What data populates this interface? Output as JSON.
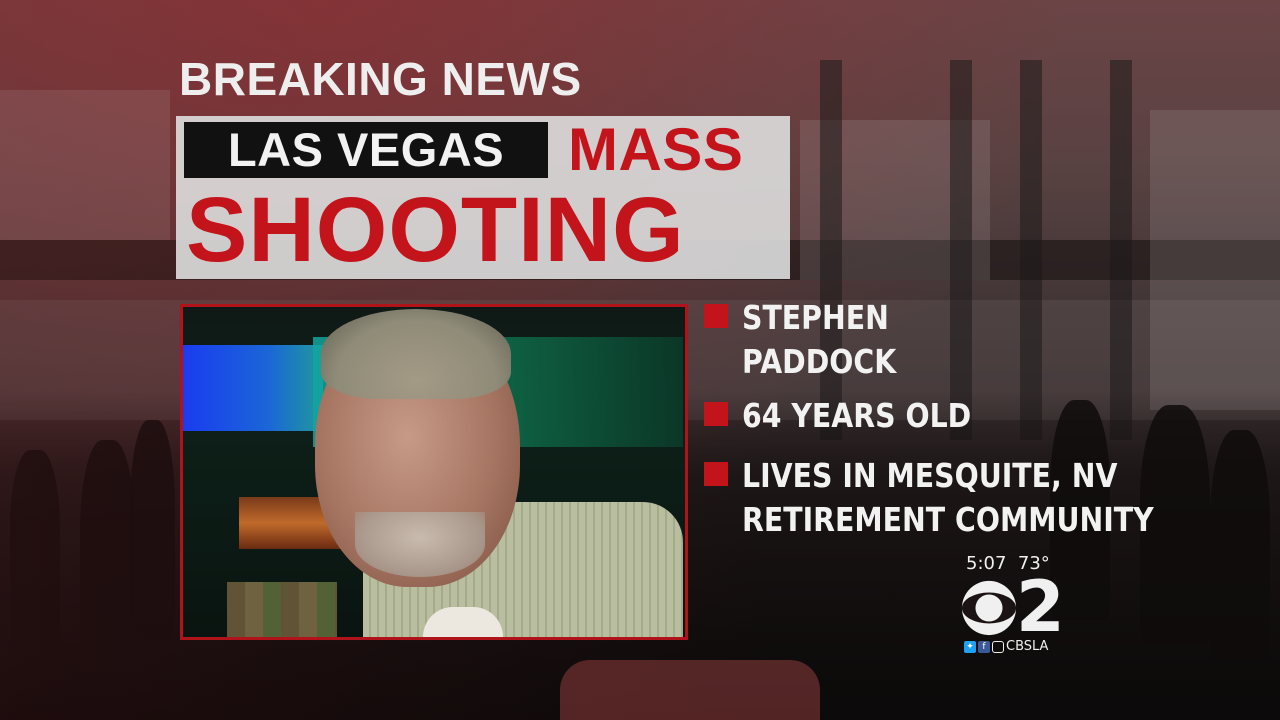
{
  "headline": {
    "kicker": "BREAKING NEWS",
    "location": "LAS VEGAS",
    "title_part1": "MASS",
    "title_part2": "SHOOTING"
  },
  "facts": [
    {
      "lines": [
        "STEPHEN",
        "PADDOCK"
      ]
    },
    {
      "lines": [
        "64 YEARS OLD"
      ]
    },
    {
      "lines": [
        "LIVES IN MESQUITE, NV",
        "RETIREMENT COMMUNITY"
      ]
    }
  ],
  "station_bug": {
    "time": "5:07",
    "temperature": "73°",
    "channel": "2",
    "handle": "CBSLA",
    "icons": [
      "cbs-eye-icon",
      "twitter-icon",
      "facebook-icon",
      "instagram-icon"
    ]
  },
  "colors": {
    "accent_red": "#c3141c",
    "panel_gray": "#dedede",
    "text_white": "#f2f2f2",
    "label_black": "#111111"
  }
}
